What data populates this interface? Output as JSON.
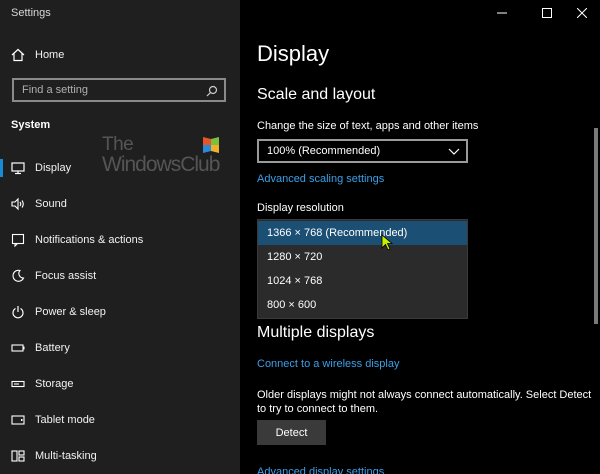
{
  "window": {
    "title": "Settings"
  },
  "sidebar": {
    "home_label": "Home",
    "search_placeholder": "Find a setting",
    "section_label": "System",
    "items": [
      {
        "label": "Display",
        "icon": "monitor-icon",
        "active": true
      },
      {
        "label": "Sound",
        "icon": "speaker-icon"
      },
      {
        "label": "Notifications & actions",
        "icon": "notifications-icon"
      },
      {
        "label": "Focus assist",
        "icon": "moon-icon"
      },
      {
        "label": "Power & sleep",
        "icon": "power-icon"
      },
      {
        "label": "Battery",
        "icon": "battery-icon"
      },
      {
        "label": "Storage",
        "icon": "storage-icon"
      },
      {
        "label": "Tablet mode",
        "icon": "tablet-icon"
      },
      {
        "label": "Multi-tasking",
        "icon": "multitasking-icon"
      }
    ]
  },
  "watermark": {
    "line1": "The",
    "line2": "WindowsClub"
  },
  "main": {
    "title": "Display",
    "scale_heading": "Scale and layout",
    "scale_label": "Change the size of text, apps and other items",
    "scale_value": "100% (Recommended)",
    "advanced_scaling_link": "Advanced scaling settings",
    "resolution_label": "Display resolution",
    "resolution_options": [
      {
        "label": "1366 × 768 (Recommended)",
        "selected": true
      },
      {
        "label": "1280 × 720"
      },
      {
        "label": "1024 × 768"
      },
      {
        "label": "800 × 600"
      }
    ],
    "multiple_heading": "Multiple displays",
    "wireless_link": "Connect to a wireless display",
    "detect_description": "Older displays might not always connect automatically. Select Detect to try to connect to them.",
    "detect_button": "Detect",
    "advanced_display_link": "Advanced display settings"
  },
  "colors": {
    "accent": "#1a8ad4",
    "link": "#3aa0e8",
    "selected_option": "#1b4f74",
    "sidebar_bg": "#1f1f1f",
    "main_bg": "#000000"
  }
}
